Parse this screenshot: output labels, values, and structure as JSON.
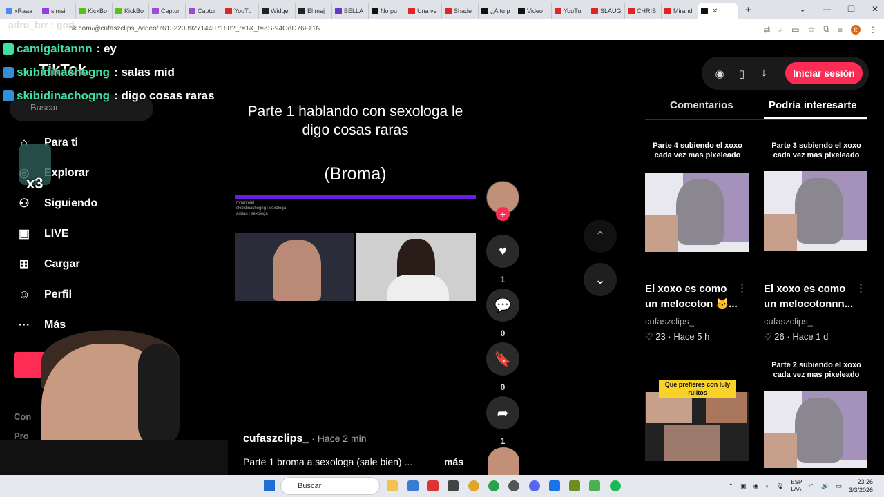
{
  "browser": {
    "tabs": [
      {
        "label": "xRaaa",
        "color": "#4c8bf5"
      },
      {
        "label": "simsin",
        "color": "#8d3fe0"
      },
      {
        "label": "KickBo",
        "color": "#53c21a"
      },
      {
        "label": "KickBo",
        "color": "#53c21a"
      },
      {
        "label": "Captur",
        "color": "#9b4bd6"
      },
      {
        "label": "Captur",
        "color": "#9b4bd6"
      },
      {
        "label": "YouTu",
        "color": "#e12323"
      },
      {
        "label": "Widge",
        "color": "#222222"
      },
      {
        "label": "El mej",
        "color": "#222222"
      },
      {
        "label": "BELLA",
        "color": "#6b33c9"
      },
      {
        "label": "No pu",
        "color": "#111111"
      },
      {
        "label": "Una ve",
        "color": "#e12323"
      },
      {
        "label": "Shade",
        "color": "#e12323"
      },
      {
        "label": "¿A tu p",
        "color": "#111111"
      },
      {
        "label": "Video",
        "color": "#111111"
      },
      {
        "label": "YouTu",
        "color": "#e12323"
      },
      {
        "label": "SLAUG",
        "color": "#e12323"
      },
      {
        "label": "CHRIS",
        "color": "#e12323"
      },
      {
        "label": "Mirand",
        "color": "#e12323"
      },
      {
        "label": "",
        "color": "#111111"
      }
    ],
    "new_tab": "+",
    "window_controls": [
      "⌄",
      "—",
      "❐",
      "✕"
    ],
    "url": "...ok.com/@cufaszclips_/video/7613220392714407188?_r=1&_t=ZS-94OdD76Fz1N",
    "profile_letter": "k"
  },
  "chat": {
    "top_faded": "adru_brr : god",
    "lines": [
      {
        "user": "camigaitannn",
        "msg": ": ey"
      },
      {
        "user": "skibidinachogng",
        "msg": ": salas mid"
      },
      {
        "user": "skibidinachogng",
        "msg": ": digo cosas raras"
      }
    ],
    "multiplier": "x3"
  },
  "sidebar": {
    "logo": "TikTok",
    "search_placeholder": "Buscar",
    "items": [
      {
        "label": "Para ti",
        "icon": "⌂"
      },
      {
        "label": "Explorar",
        "icon": "◎"
      },
      {
        "label": "Siguiendo",
        "icon": "⚇"
      },
      {
        "label": "LIVE",
        "icon": "▣"
      },
      {
        "label": "Cargar",
        "icon": "⊞"
      },
      {
        "label": "Perfil",
        "icon": "☺"
      },
      {
        "label": "Más",
        "icon": "···"
      }
    ],
    "footer": [
      "Con",
      "Pro"
    ]
  },
  "video": {
    "title": "Parte 1 hablando con sexologa le digo cosas raras",
    "subtitle": "(Broma)",
    "mini_chat": [
      "mmmmiel : ",
      "skibidinachogng : sexologa",
      "adrian : sexologa"
    ],
    "author": "cufaszclips_",
    "posted": "· Hace 2 min",
    "description": "Parte 1 broma a sexologa (sale bien) ...",
    "more": "más",
    "actions": [
      {
        "icon": "♥",
        "count": "1"
      },
      {
        "icon": "💬",
        "count": "0"
      },
      {
        "icon": "🔖",
        "count": "0"
      },
      {
        "icon": "➦",
        "count": "1"
      }
    ]
  },
  "nav_arrows": {
    "up": "⌃",
    "down": "⌄"
  },
  "right_panel": {
    "login_label": "Iniciar sesión",
    "tabs": [
      "Comentarios",
      "Podría interesarte"
    ],
    "cards": [
      {
        "thumb_text": "Parte 4 subiendo el xoxo cada vez mas pixeleado",
        "title": "El xoxo es como un melocoton 🐱...",
        "user": "cufaszclips_",
        "likes": "23",
        "time": "Hace 5 h"
      },
      {
        "thumb_text": "Parte 3 subiendo el xoxo cada vez mas pixeleado",
        "title": "El xoxo es como un melocotonnn...",
        "user": "cufaszclips_",
        "likes": "26",
        "time": "Hace 1 d"
      },
      {
        "thumb_text": "Que prefieres con luly rulitos"
      },
      {
        "thumb_text": "Parte 2 subiendo el xoxo cada vez mas pixeleado"
      }
    ]
  },
  "taskbar": {
    "search": "Buscar",
    "lang": "ESP\nLAA",
    "time": "23:26",
    "date": "3/3/2026"
  },
  "colors": {
    "accent": "#fe2c55",
    "chat_user": "#3fe0a0"
  }
}
